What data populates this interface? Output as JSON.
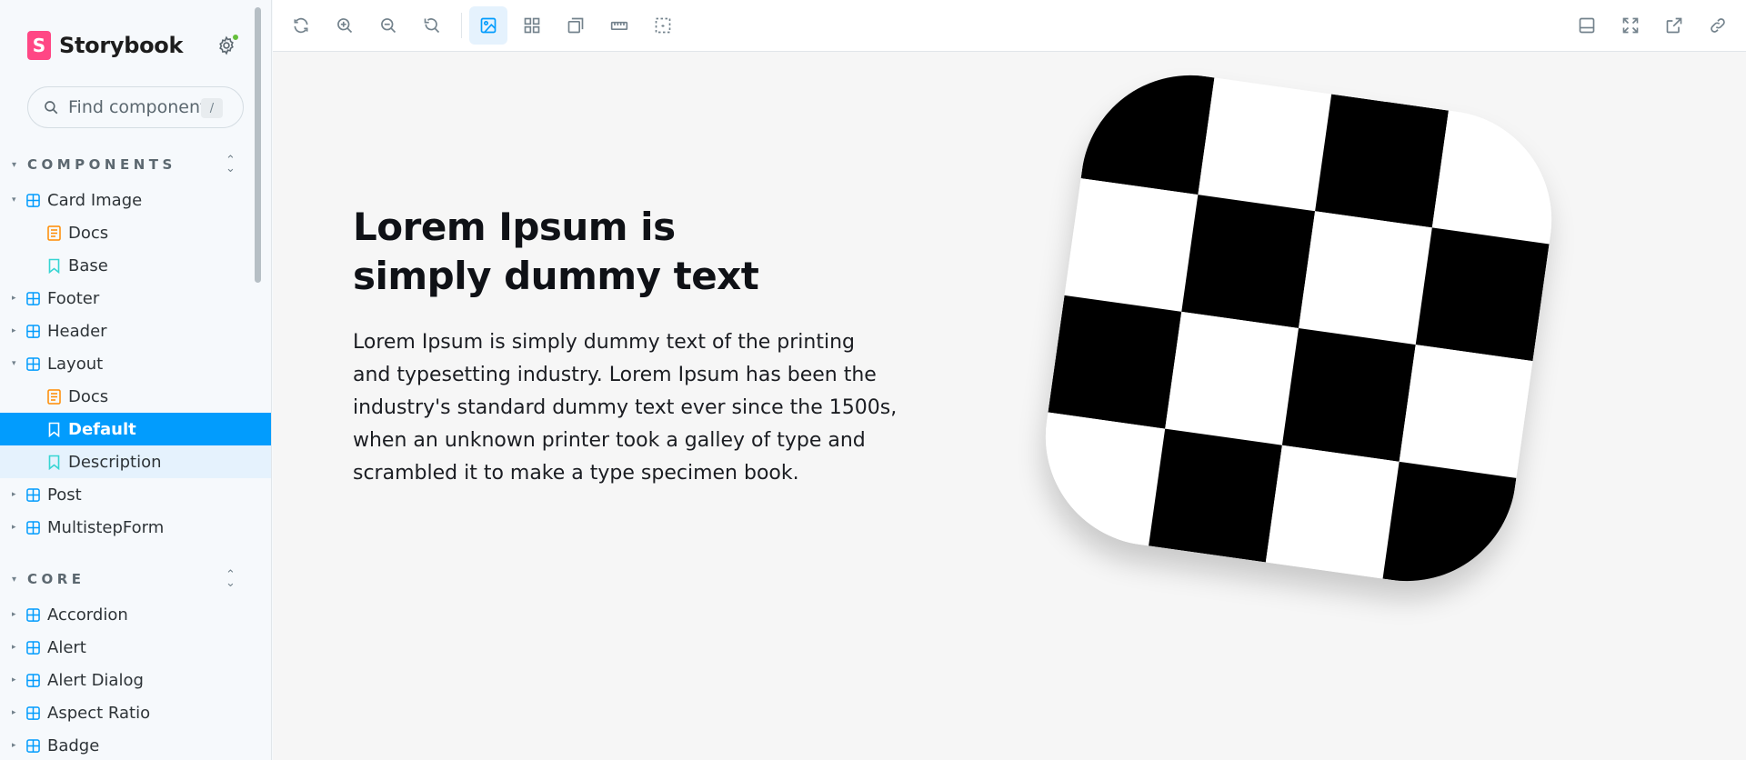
{
  "brand": {
    "name": "Storybook",
    "logo_letter": "S",
    "logo_color": "#ff4785"
  },
  "search": {
    "placeholder": "Find components",
    "shortcut": "/"
  },
  "sections": [
    {
      "title": "COMPONENTS"
    },
    {
      "title": "CORE"
    }
  ],
  "tree": {
    "card_image": "Card Image",
    "card_image_docs": "Docs",
    "card_image_base": "Base",
    "footer": "Footer",
    "header": "Header",
    "layout": "Layout",
    "layout_docs": "Docs",
    "layout_default": "Default",
    "layout_description": "Description",
    "post": "Post",
    "multistep_form": "MultistepForm",
    "accordion": "Accordion",
    "alert": "Alert",
    "alert_dialog": "Alert Dialog",
    "aspect_ratio": "Aspect Ratio",
    "badge": "Badge"
  },
  "colors": {
    "selected": "#029cfd",
    "component_icon": "#029cfd",
    "docs_icon": "#ff8b00",
    "story_icon": "#37d5d3",
    "status_dot": "#66bf3c"
  },
  "toolbar": {
    "left_icons": [
      "reload-icon",
      "zoom-in-icon",
      "zoom-out-icon",
      "reset-zoom-icon",
      "background-icon",
      "grid-icon",
      "viewport-icon",
      "measure-icon",
      "outline-icon"
    ],
    "right_icons": [
      "addons-panel-icon",
      "fullscreen-icon",
      "open-new-tab-icon",
      "copy-link-icon"
    ],
    "active": "background-icon"
  },
  "story": {
    "heading": "Lorem Ipsum is simply dummy text",
    "paragraph": "Lorem Ipsum is simply dummy text of the printing and typesetting industry. Lorem Ipsum has been the industry's standard dummy text ever since the 1500s, when an unknown printer took a galley of type and scrambled it to make a type specimen book."
  }
}
